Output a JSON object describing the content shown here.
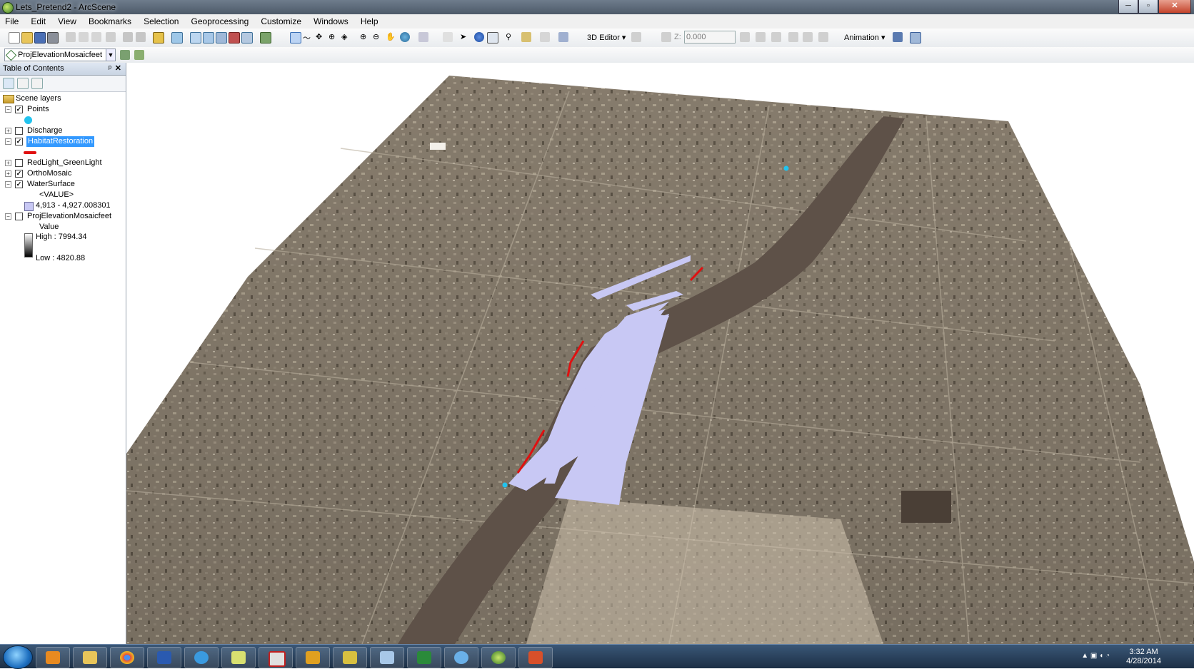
{
  "window": {
    "title": "Lets_Pretend2 - ArcScene",
    "minimize": "─",
    "maximize": "▫",
    "close": "✕"
  },
  "menu": [
    "File",
    "Edit",
    "View",
    "Bookmarks",
    "Selection",
    "Geoprocessing",
    "Customize",
    "Windows",
    "Help"
  ],
  "toolbar": {
    "editor_3d": "3D Editor ▾",
    "z_label": "Z:",
    "z_value": "0.000",
    "animation": "Animation ▾"
  },
  "layer_selector": {
    "value": "ProjElevationMosaicfeet"
  },
  "toc": {
    "title": "Table of Contents",
    "pin": "ᵖ",
    "close": "✕",
    "root": "Scene layers",
    "layers": [
      {
        "name": "Points",
        "checked": true
      },
      {
        "name": "Discharge",
        "checked": false
      },
      {
        "name": "HabitatRestoration",
        "checked": true
      },
      {
        "name": "RedLight_GreenLight",
        "checked": false
      },
      {
        "name": "OrthoMosaic",
        "checked": true
      },
      {
        "name": "WaterSurface",
        "checked": true
      },
      {
        "name": "ProjElevationMosaicfeet",
        "checked": false
      }
    ],
    "water_field": "<VALUE>",
    "water_range": "4,913 - 4,927.008301",
    "elev_field": "Value",
    "elev_high": "High : 7994.34",
    "elev_low": "Low : 4820.88",
    "colors": {
      "points": "#22c3ee",
      "habitat": "#e01010",
      "water": "#c8c8f4"
    }
  },
  "clock": {
    "time": "3:32 AM",
    "date": "4/28/2014"
  }
}
